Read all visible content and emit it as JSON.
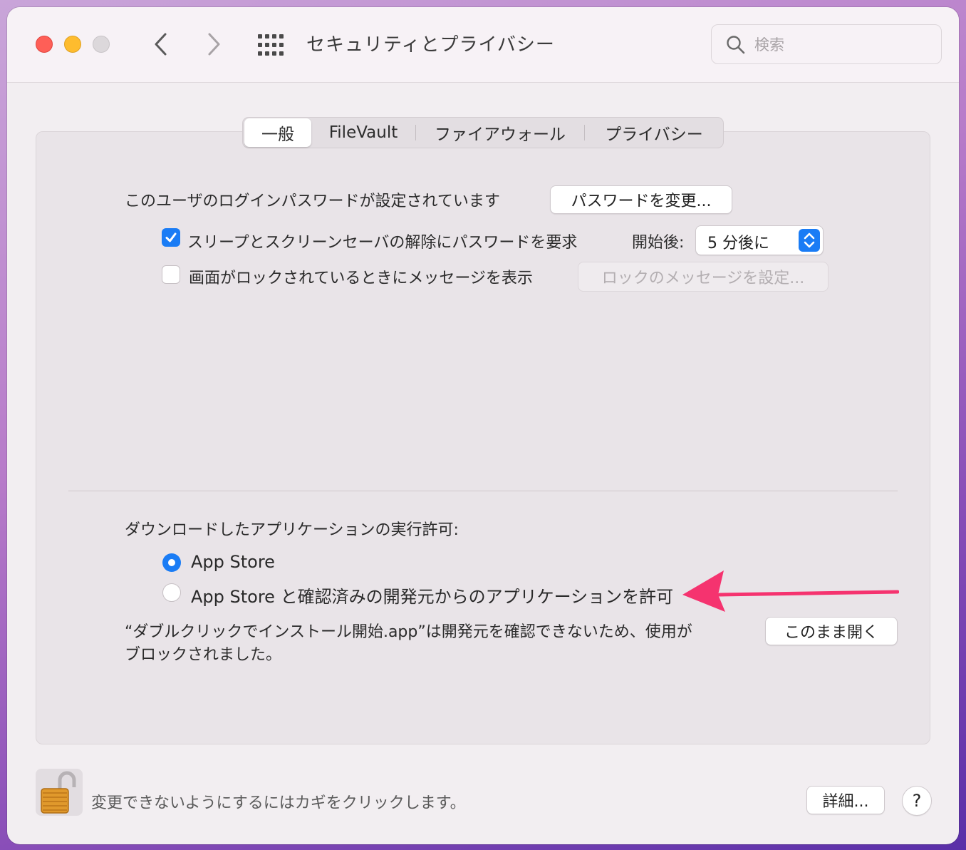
{
  "window": {
    "title": "セキュリティとプライバシー",
    "search_placeholder": "検索"
  },
  "tabs": [
    {
      "label": "一般",
      "active": true
    },
    {
      "label": "FileVault",
      "active": false
    },
    {
      "label": "ファイアウォール",
      "active": false
    },
    {
      "label": "プライバシー",
      "active": false
    }
  ],
  "general": {
    "login_password_text": "このユーザのログインパスワードが設定されています",
    "change_password_button": "パスワードを変更...",
    "require_password": {
      "label": "スリープとスクリーンセーバの解除にパスワードを要求",
      "checked": true
    },
    "after_label": "開始後:",
    "after_value": "5 分後に",
    "show_message": {
      "label": "画面がロックされているときにメッセージを表示",
      "checked": false
    },
    "set_lock_message_button": "ロックのメッセージを設定..."
  },
  "downloads": {
    "heading": "ダウンロードしたアプリケーションの実行許可:",
    "options": [
      {
        "label": "App Store",
        "selected": true
      },
      {
        "label": "App Store と確認済みの開発元からのアプリケーションを許可",
        "selected": false
      }
    ],
    "blocked_line1": "“ダブルクリックでインストール開始.app”は開発元を確認できないため、使用が",
    "blocked_line2": "ブロックされました。",
    "open_anyway_button": "このまま開く"
  },
  "footer": {
    "lock_text": "変更できないようにするにはカギをクリックします。",
    "advanced_button": "詳細...",
    "help_label": "?"
  },
  "colors": {
    "accent": "#1a7cf5",
    "annotation_arrow": "#f5336f"
  },
  "icons": [
    "back-chevron-icon",
    "forward-chevron-icon",
    "grid-icon",
    "search-icon",
    "checkmark-icon",
    "stepper-icon",
    "padlock-open-icon",
    "annotation-arrow"
  ]
}
